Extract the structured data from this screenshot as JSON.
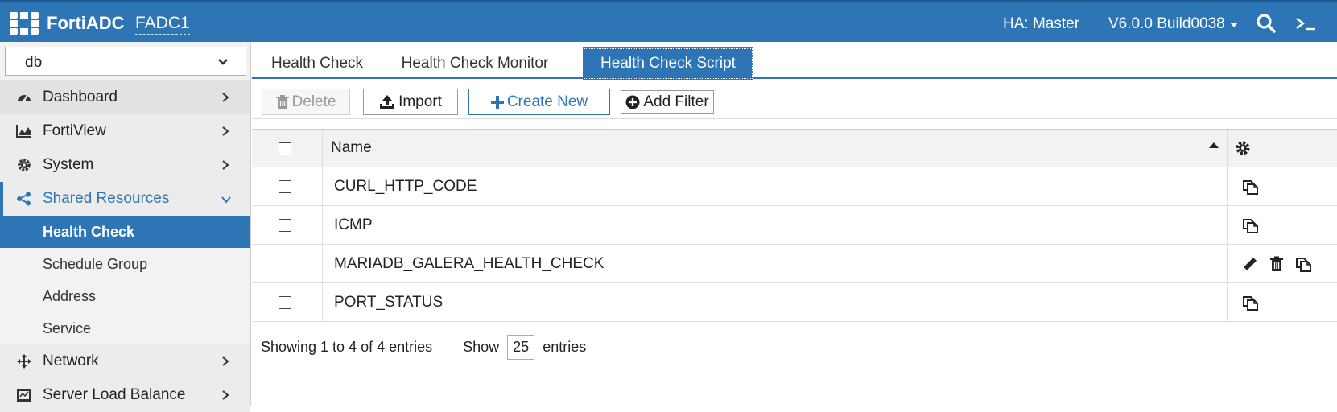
{
  "topbar": {
    "brand": "FortiADC",
    "device_name": "FADC1",
    "ha_status": "HA: Master",
    "version": "V6.0.0 Build0038",
    "icons": [
      "fortinet-logo-icon",
      "search-icon",
      "console-icon"
    ]
  },
  "sidebar": {
    "vdom_value": "db",
    "items": [
      {
        "label": "Dashboard",
        "icon": "dashboard-icon"
      },
      {
        "label": "FortiView",
        "icon": "chart-icon"
      },
      {
        "label": "System",
        "icon": "gear-icon"
      },
      {
        "label": "Shared Resources",
        "icon": "share-icon"
      },
      {
        "label": "Network",
        "icon": "move-icon"
      },
      {
        "label": "Server Load Balance",
        "icon": "balance-icon"
      }
    ],
    "sub_items": [
      "Health Check",
      "Schedule Group",
      "Address",
      "Service"
    ]
  },
  "tabs": [
    "Health Check",
    "Health Check Monitor",
    "Health Check Script"
  ],
  "active_tab": "Health Check Script",
  "toolbar": {
    "delete_label": "Delete",
    "import_label": "Import",
    "create_label": "Create New",
    "filter_label": "Add Filter"
  },
  "table": {
    "header_name": "Name",
    "rows": [
      {
        "name": "CURL_HTTP_CODE",
        "actions": [
          "clone"
        ]
      },
      {
        "name": "ICMP",
        "actions": [
          "clone"
        ]
      },
      {
        "name": "MARIADB_GALERA_HEALTH_CHECK",
        "actions": [
          "edit",
          "delete",
          "clone"
        ]
      },
      {
        "name": "PORT_STATUS",
        "actions": [
          "clone"
        ]
      }
    ]
  },
  "footer": {
    "showing": "Showing 1 to 4 of 4 entries",
    "show_label": "Show",
    "page_size": "25",
    "entries_label": "entries"
  },
  "colors": {
    "accent": "#2e75b6",
    "sidebar_bg": "#f2f2f2"
  }
}
